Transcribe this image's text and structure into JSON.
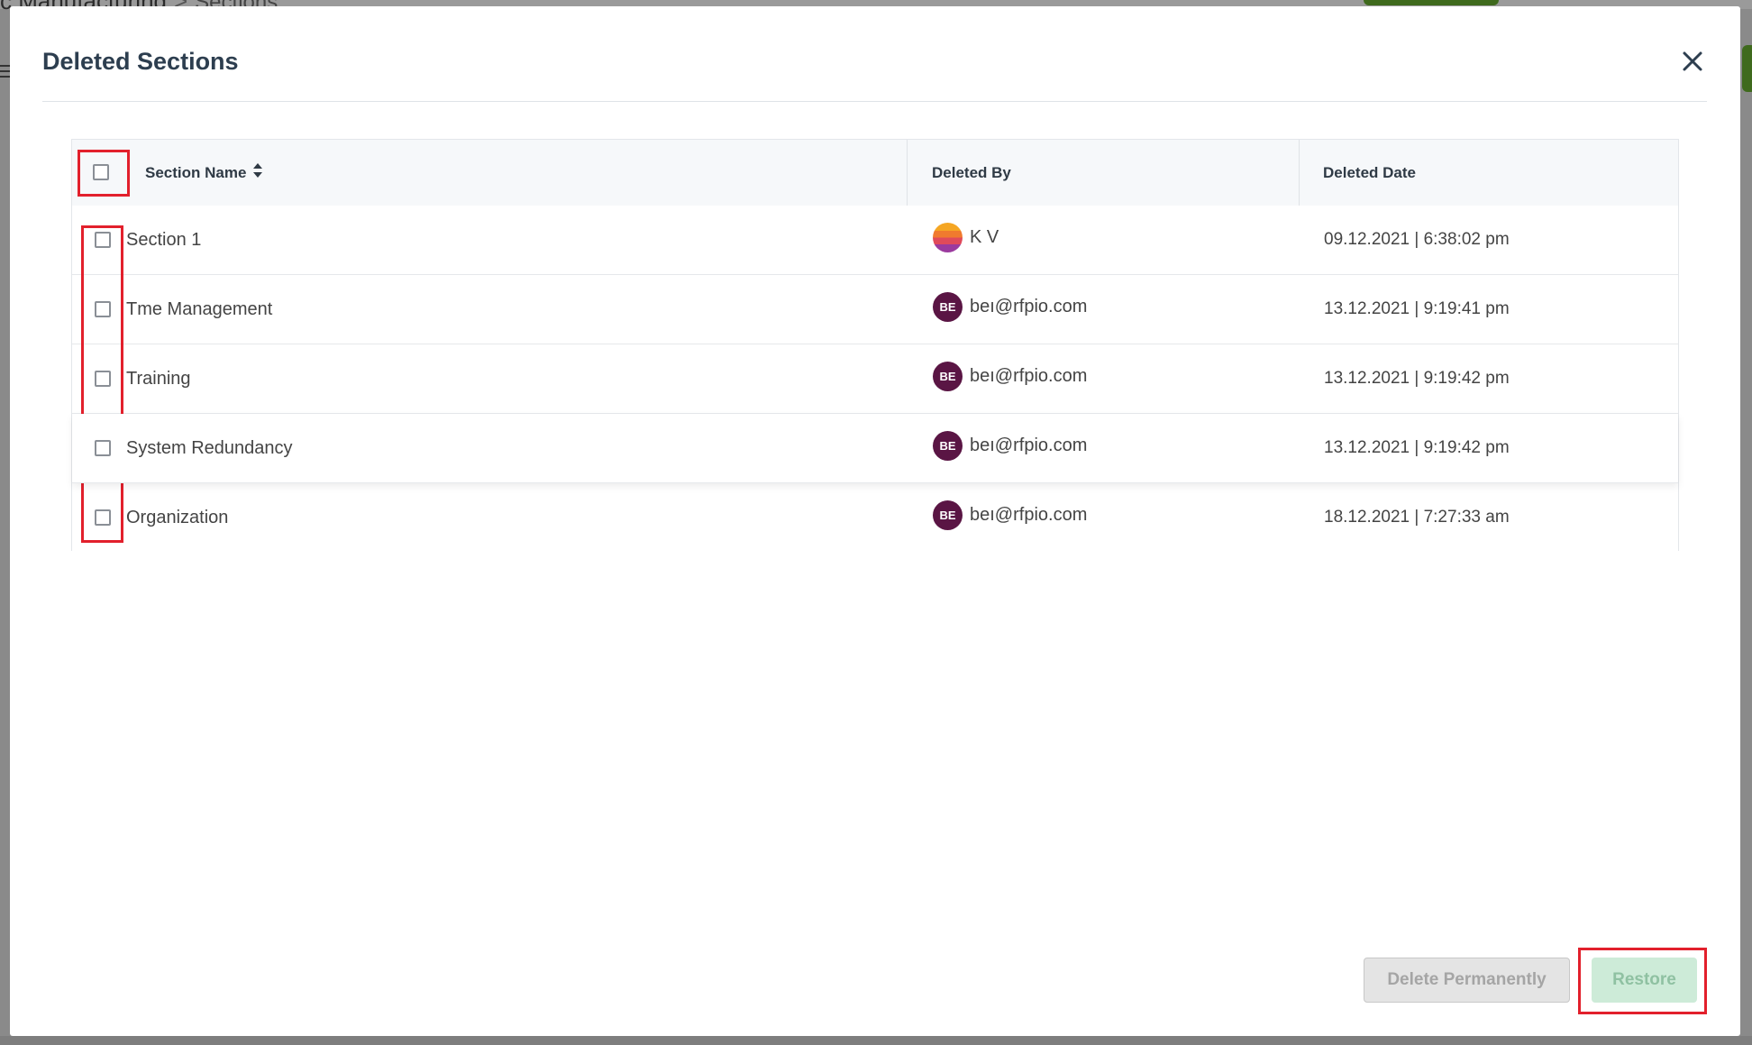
{
  "background": {
    "breadcrumb_parent": "c Manufacturing",
    "breadcrumb_separator": ">",
    "breadcrumb_current": "Sections"
  },
  "modal": {
    "title": "Deleted Sections",
    "close_icon": "close-icon"
  },
  "table": {
    "columns": {
      "section_name": "Section Name",
      "deleted_by": "Deleted By",
      "deleted_date": "Deleted Date"
    },
    "sort_icon": "sort-icon",
    "rows": [
      {
        "name": "Section 1",
        "deleted_by": "K V",
        "avatar_type": "image",
        "avatar_initials": "",
        "deleted_date": "09.12.2021 | 6:38:02 pm"
      },
      {
        "name": "Tme Management",
        "deleted_by": "beı@rfpio.com",
        "avatar_type": "initials",
        "avatar_initials": "BE",
        "deleted_date": "13.12.2021 | 9:19:41 pm"
      },
      {
        "name": "Training",
        "deleted_by": "beı@rfpio.com",
        "avatar_type": "initials",
        "avatar_initials": "BE",
        "deleted_date": "13.12.2021 | 9:19:42 pm"
      },
      {
        "name": "System Redundancy",
        "deleted_by": "beı@rfpio.com",
        "avatar_type": "initials",
        "avatar_initials": "BE",
        "deleted_date": "13.12.2021 | 9:19:42 pm"
      },
      {
        "name": "Organization",
        "deleted_by": "beı@rfpio.com",
        "avatar_type": "initials",
        "avatar_initials": "BE",
        "deleted_date": "18.12.2021 | 7:27:33 am"
      }
    ]
  },
  "footer": {
    "delete_label": "Delete Permanently",
    "restore_label": "Restore"
  },
  "colors": {
    "annotation_red": "#e2202c",
    "restore_bg": "#cdebd8",
    "avatar_bg": "#5a1544",
    "title_color": "#2d3e4f"
  }
}
